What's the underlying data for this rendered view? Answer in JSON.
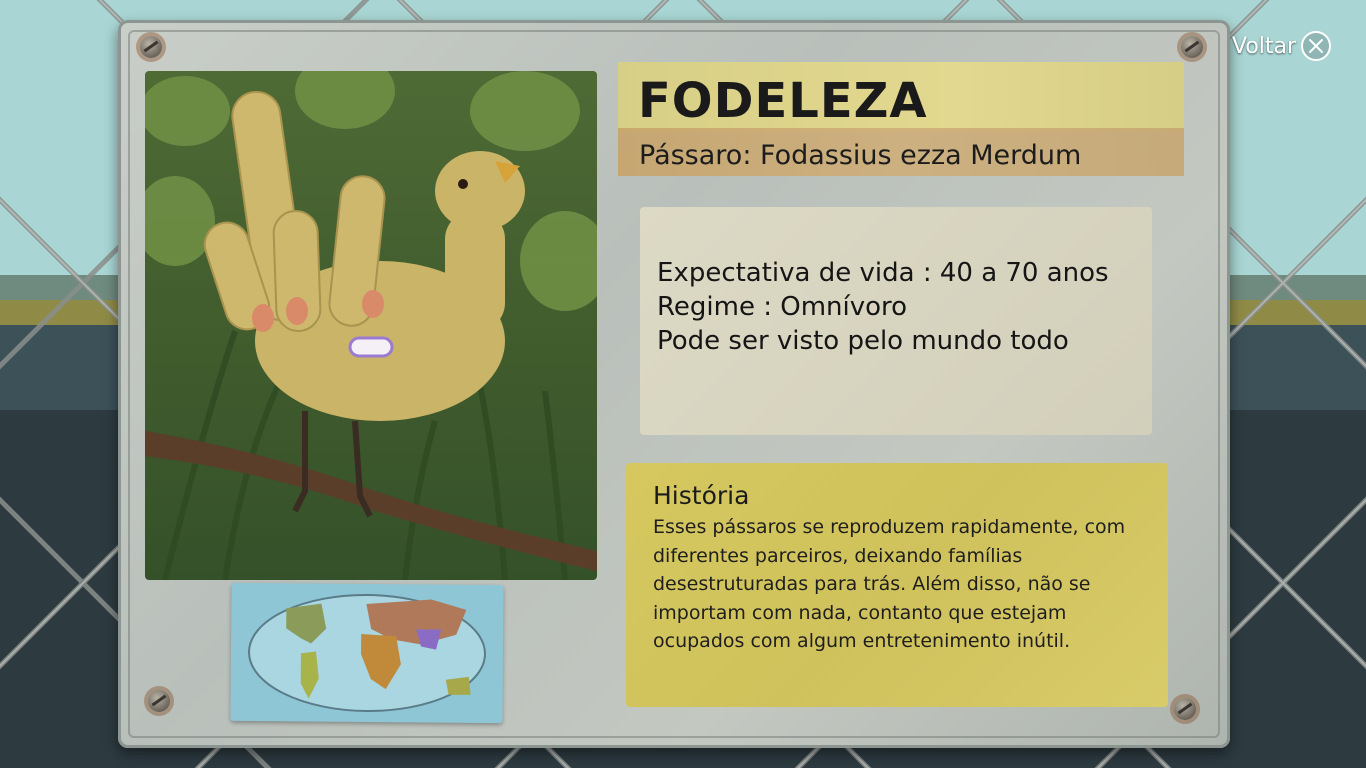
{
  "header": {
    "back_label": "Voltar"
  },
  "card": {
    "name": "FODELEZA",
    "subtitle": "Pássaro: Fodassius ezza Merdum",
    "stats": [
      "Expectativa de vida : 40 a 70 anos",
      "Regime : Omnívoro",
      "Pode ser visto pelo mundo todo"
    ],
    "history_title": "História",
    "history_text": "Esses pássaros se reproduzem rapidamente, com diferentes parceiros, deixando famílias desestruturadas para trás. Além disso, não se importam com nada, contanto que estejam ocupados com algum entretenimento inútil."
  },
  "icons": {
    "close": "close-circle-icon",
    "screw": "screw-icon"
  },
  "colors": {
    "title_band": "#e2d88f",
    "subtitle_band": "#cfae7a",
    "history_panel": "#d6c85f",
    "stats_panel": "#dcd9c5"
  }
}
